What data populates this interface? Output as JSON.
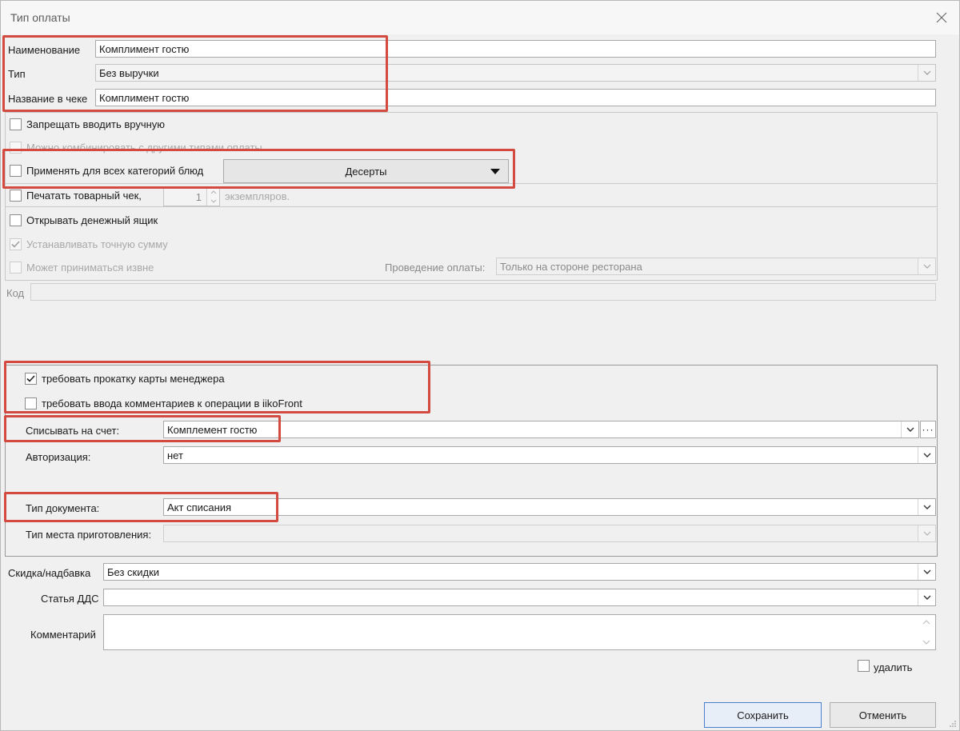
{
  "window": {
    "title": "Тип оплаты"
  },
  "name": {
    "label": "Наименование",
    "value": "Комплимент гостю"
  },
  "type": {
    "label": "Тип",
    "value": "Без выручки"
  },
  "receipt_name": {
    "label": "Название в чеке",
    "value": "Комплимент гостю"
  },
  "options": {
    "forbid_manual": "Запрещать вводить вручную",
    "combine": "Можно комбинировать с другими типами оплаты",
    "apply_all": "Применять для всех категорий блюд",
    "category_value": "Десерты",
    "print_receipt": "Печатать товарный чек,",
    "copies_value": "1",
    "copies_unit": "экземпляров.",
    "open_drawer": "Открывать денежный ящик",
    "exact_sum": "Устанавливать точную сумму",
    "external": "Может приниматься извне",
    "processing_label": "Проведение оплаты:",
    "processing_value": "Только на стороне ресторана"
  },
  "code": {
    "label": "Код",
    "value": ""
  },
  "nonrevenue": {
    "require_card": "требовать прокатку карты менеджера",
    "require_comment": "требовать ввода комментариев к операции в iikoFront",
    "account_label": "Списывать на счет:",
    "account_value": "Комплемент гостю",
    "auth_label": "Авторизация:",
    "auth_value": "нет",
    "doc_type_label": "Тип документа:",
    "doc_type_value": "Акт списания",
    "place_type_label": "Тип места приготовления:",
    "place_type_value": ""
  },
  "discount": {
    "label": "Скидка/надбавка",
    "value": "Без скидки"
  },
  "dds": {
    "label": "Статья ДДС",
    "value": ""
  },
  "comment": {
    "label": "Комментарий",
    "value": ""
  },
  "delete_label": "удалить",
  "buttons": {
    "save": "Сохранить",
    "cancel": "Отменить"
  },
  "colors": {
    "highlight": "#d24a40",
    "primary_border": "#4a7fd0"
  }
}
